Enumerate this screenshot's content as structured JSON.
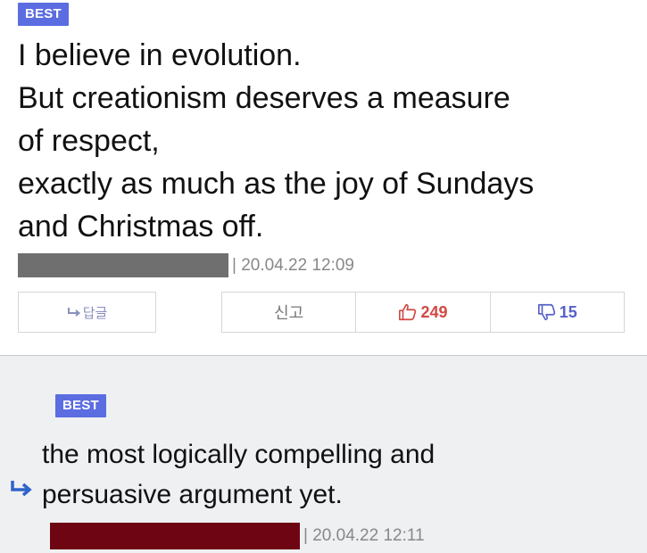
{
  "post": {
    "badge": "BEST",
    "lines": [
      "I believe in evolution.",
      "But creationism deserves a measure",
      "of respect,",
      "exactly as much as the joy of Sundays",
      "and Christmas off."
    ],
    "date": "| 20.04.22 12:09"
  },
  "actions": {
    "reply_label": "답글",
    "report_label": "신고",
    "upvotes": "249",
    "downvotes": "15"
  },
  "reply": {
    "badge": "BEST",
    "lines": [
      "the most logically compelling and",
      "persuasive argument yet."
    ],
    "date": "| 20.04.22 12:11"
  },
  "colors": {
    "badge": "#5b6de0",
    "upvote": "#d14a43",
    "downvote": "#5561c8",
    "reply_background": "#eff0f2",
    "redaction_gray": "#6f6f6f",
    "redaction_red": "#6d0612"
  }
}
